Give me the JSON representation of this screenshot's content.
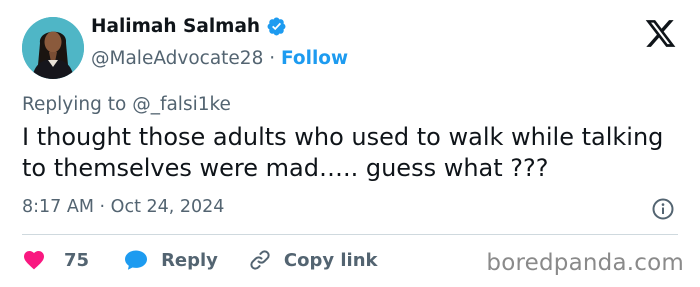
{
  "user": {
    "display_name": "Halimah Salmah",
    "handle": "@MaleAdvocate28",
    "separator": "·",
    "follow_label": "Follow"
  },
  "tweet": {
    "replying_prefix": "Replying to",
    "replying_to": "@_falsi1ke",
    "text": "I thought those adults who used to walk while talking to themselves were mad….. guess what ???",
    "time": "8:17 AM",
    "meta_separator": "·",
    "date": "Oct 24, 2024"
  },
  "actions": {
    "like_count": "75",
    "reply_label": "Reply",
    "copy_link_label": "Copy link"
  },
  "watermark": "boredpanda.com",
  "colors": {
    "accent": "#1d9bf0",
    "like": "#f91880",
    "text": "#0f1419",
    "secondary": "#536471",
    "divider": "#cfd9de",
    "avatar_bg": "#4fb6c6"
  },
  "icons": {
    "verified": "verified-badge-icon",
    "logo": "x-logo-icon",
    "info": "info-icon",
    "like": "heart-icon",
    "reply": "speech-bubble-icon",
    "copy_link": "link-icon"
  }
}
